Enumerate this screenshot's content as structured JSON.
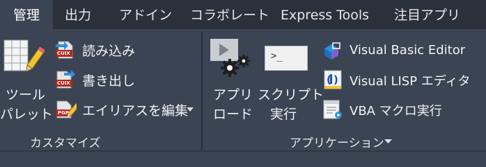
{
  "tabs": [
    {
      "label": "管理",
      "active": true
    },
    {
      "label": "出力",
      "active": false
    },
    {
      "label": "アドイン",
      "active": false
    },
    {
      "label": "コラボレート",
      "active": false
    },
    {
      "label": "Express Tools",
      "active": false
    },
    {
      "label": "注目アプリ",
      "active": false
    }
  ],
  "customize": {
    "tool_palette_line1": "ツール",
    "tool_palette_line2": "パレット",
    "import_label": "読み込み",
    "export_label": "書き出し",
    "alias_edit_label": "エイリアスを編集",
    "panel_title": "カスタマイズ",
    "cuix_badge": "CUIX",
    "pgp_badge": "PGP"
  },
  "applications": {
    "load_app_line1": "アプリ",
    "load_app_line2": "ロード",
    "run_script_line1": "スクリプト",
    "run_script_line2": "実行",
    "script_prompt": ">_",
    "vba_editor_label": "Visual Basic Editor",
    "vlisp_editor_label": "Visual LISP エディタ",
    "vba_macro_label": "VBA マクロ実行",
    "panel_title": "アプリケーション"
  },
  "colors": {
    "tab_bar_bg": "#2b313b",
    "panel_bg": "#3b4453",
    "text": "#f2f2f2",
    "accent_blue": "#2f8fe0",
    "accent_red": "#c23a3a"
  },
  "icons": {
    "tool_palette": "tool-palette-icon",
    "import": "cuix-import-icon",
    "export": "cuix-export-icon",
    "alias": "pgp-alias-icon",
    "load_app": "load-application-icon",
    "run_script": "run-script-icon",
    "vba_editor": "visual-basic-editor-icon",
    "vlisp": "visual-lisp-icon",
    "vba_macro": "vba-macro-icon",
    "dropdown": "chevron-down-icon"
  }
}
